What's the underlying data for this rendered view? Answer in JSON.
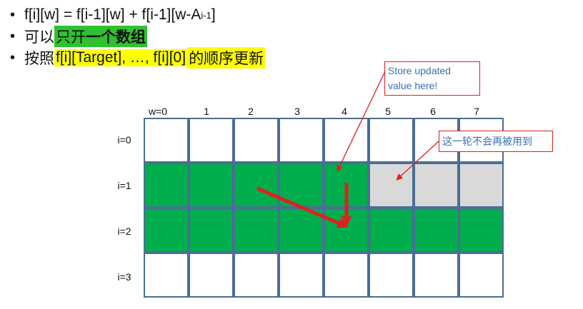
{
  "bullets": [
    {
      "dot": "•",
      "pre": "f[i][w] = f[i-1][w] + f[i-1][w-A",
      "sub": "i-1",
      "post": "]"
    },
    {
      "dot": "•",
      "pre": "可以",
      "hl": "只开",
      "hl_bold": "一个数组"
    },
    {
      "dot": "•",
      "pre": "按照",
      "hl": "f[i][Target], …, f[i][0]",
      "post": "的顺序更新"
    }
  ],
  "grid": {
    "col_labels": [
      "w=0",
      "1",
      "2",
      "3",
      "4",
      "5",
      "6",
      "7"
    ],
    "row_labels": [
      "i=0",
      "i=1",
      "i=2",
      "i=3"
    ],
    "rows": [
      [
        "white",
        "white",
        "white",
        "white",
        "white",
        "white",
        "white",
        "white"
      ],
      [
        "green",
        "green",
        "green",
        "green",
        "green",
        "gray",
        "gray",
        "gray"
      ],
      [
        "green",
        "green",
        "green",
        "green",
        "green",
        "green",
        "green",
        "green"
      ],
      [
        "white",
        "white",
        "white",
        "white",
        "white",
        "white",
        "white",
        "white"
      ]
    ]
  },
  "callouts": {
    "store": {
      "line1": "Store updated",
      "line2": "value here!"
    },
    "unused": {
      "text": "这一轮不会再被用到"
    }
  },
  "colors": {
    "green": "#00ae4d",
    "gray": "#d9d9d9",
    "border": "#4a6e95",
    "arrow": "#e02020",
    "highlight_green": "#2fc12f",
    "highlight_yellow": "#ffff00",
    "callout_text": "#3a6fb8"
  }
}
